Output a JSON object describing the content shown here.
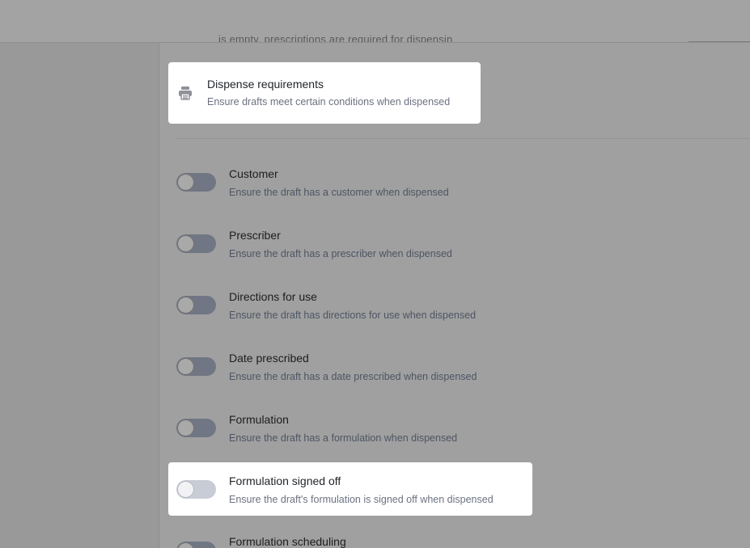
{
  "colors": {
    "overlay_bg": "#9b9b9b",
    "highlight_bg": "#ffffff",
    "toggle_off": "#707683",
    "title_text": "#1f2328",
    "desc_text": "#6b7280"
  },
  "header": {
    "partial_text": "is empty, prescriptions are required for dispensing"
  },
  "section": {
    "icon": "printer-icon",
    "title": "Dispense requirements",
    "description": "Ensure drafts meet certain conditions when dispensed"
  },
  "requirements": [
    {
      "title": "Customer",
      "description": "Ensure the draft has a customer when dispensed",
      "enabled": false
    },
    {
      "title": "Prescriber",
      "description": "Ensure the draft has a prescriber when dispensed",
      "enabled": false
    },
    {
      "title": "Directions for use",
      "description": "Ensure the draft has directions for use when dispensed",
      "enabled": false
    },
    {
      "title": "Date prescribed",
      "description": "Ensure the draft has a date prescribed when dispensed",
      "enabled": false
    },
    {
      "title": "Formulation",
      "description": "Ensure the draft has a formulation when dispensed",
      "enabled": false
    },
    {
      "title": "Formulation signed off",
      "description": "Ensure the draft's formulation is signed off when dispensed",
      "enabled": false
    },
    {
      "title": "Formulation scheduling",
      "description": "",
      "enabled": false
    }
  ]
}
